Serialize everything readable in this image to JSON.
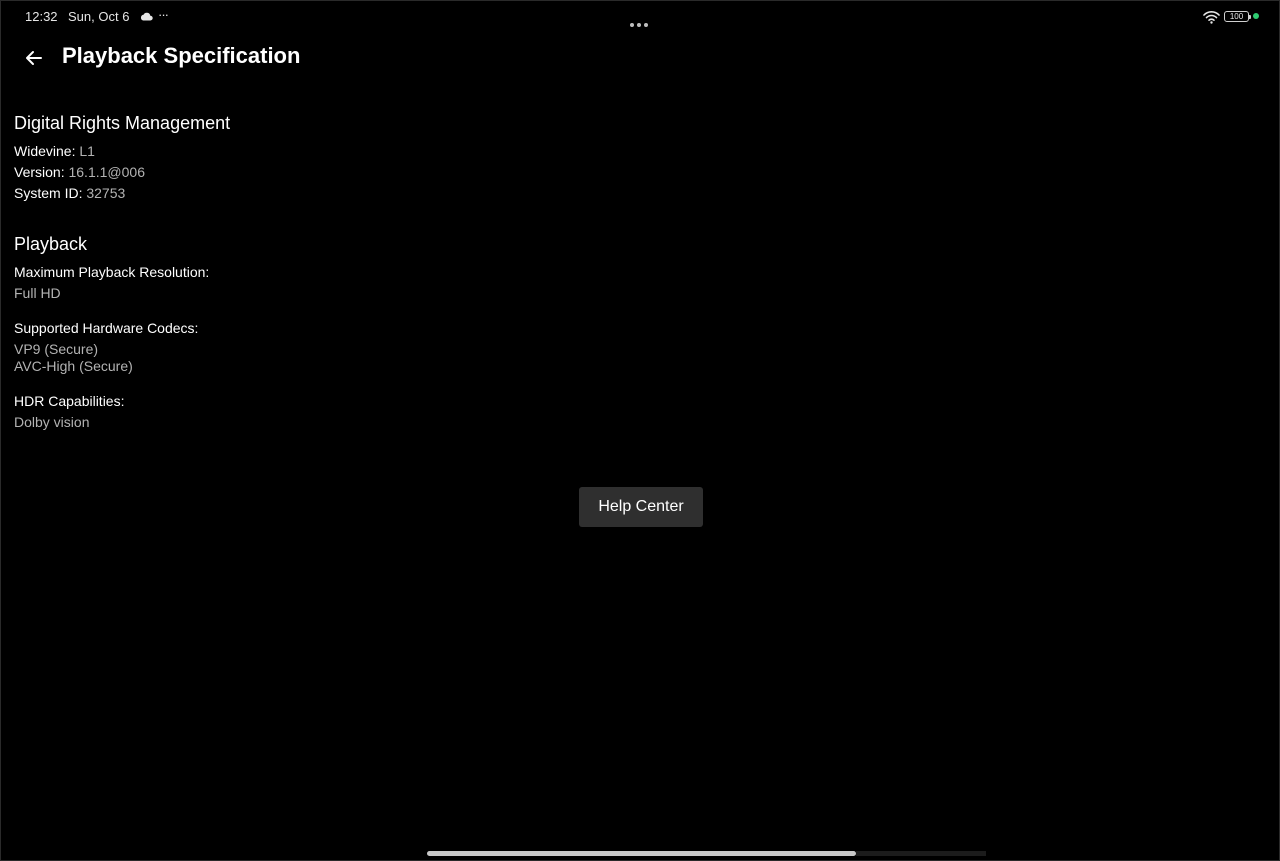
{
  "status_bar": {
    "time": "12:32",
    "date": "Sun, Oct 6",
    "overflow": "···",
    "battery": "100",
    "icons": [
      "cloud-icon",
      "wifi-icon",
      "battery-icon",
      "privacy-dot-icon"
    ]
  },
  "header": {
    "back_icon": "arrow-left-icon",
    "title": "Playback Specification"
  },
  "drm": {
    "title": "Digital Rights Management",
    "widevine_label": "Widevine:",
    "widevine_value": "L1",
    "version_label": "Version:",
    "version_value": "16.1.1@006",
    "system_id_label": "System ID:",
    "system_id_value": "32753"
  },
  "playback": {
    "title": "Playback",
    "max_res_label": "Maximum Playback Resolution:",
    "max_res_value": "Full HD",
    "codecs_label": "Supported Hardware Codecs:",
    "codecs": [
      "VP9 (Secure)",
      "AVC-High (Secure)"
    ],
    "hdr_label": "HDR Capabilities:",
    "hdr_value": "Dolby vision"
  },
  "help_button": {
    "label": "Help Center"
  },
  "colors": {
    "background": "#000000",
    "text_primary": "#ffffff",
    "text_secondary": "#b3b3b3",
    "button_bg": "#2f2f2f",
    "privacy_dot": "#2ecc71"
  }
}
